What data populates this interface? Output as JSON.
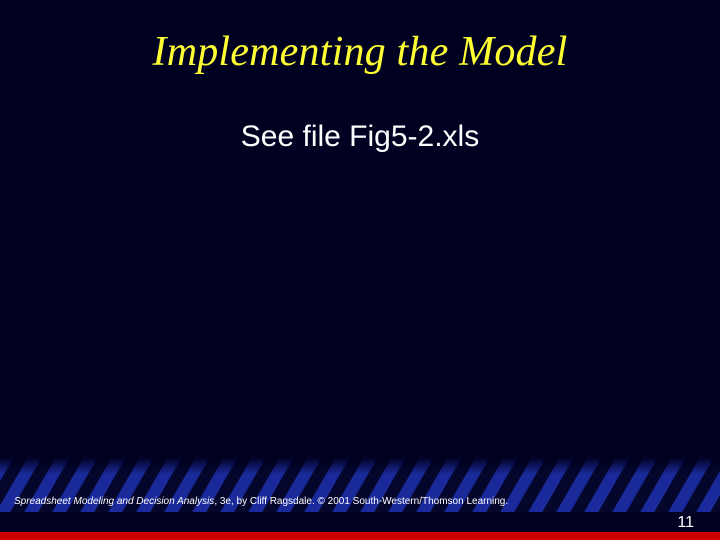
{
  "slide": {
    "title": "Implementing the Model",
    "body": "See file Fig5-2.xls"
  },
  "footer": {
    "book_title": "Spreadsheet Modeling and Decision Analysis",
    "rest": ", 3e, by Cliff Ragsdale. © 2001 South-Western/Thomson Learning."
  },
  "page_number": "11",
  "colors": {
    "title": "#ffff33",
    "background": "#000020",
    "accent_red": "#cc0000",
    "stripe_blue": "#1a2a9a"
  }
}
